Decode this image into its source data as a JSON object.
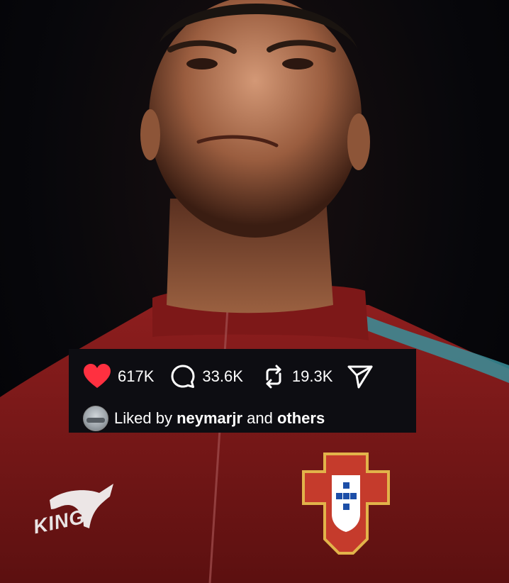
{
  "post": {
    "likes_count": "617K",
    "comments_count": "33.6K",
    "reposts_count": "19.3K",
    "liked_prefix": "Liked by ",
    "liked_user": "neymarjr",
    "liked_joiner": " and ",
    "liked_others": "others"
  },
  "photo": {
    "jacket_brand_text": "KING"
  },
  "icons": {
    "like": "heart-icon",
    "comment": "comment-bubble-icon",
    "repost": "repost-icon",
    "share": "send-icon"
  },
  "colors": {
    "heart": "#ff3040",
    "bar_background": "#0d0d12",
    "jacket": "#7a1616"
  }
}
